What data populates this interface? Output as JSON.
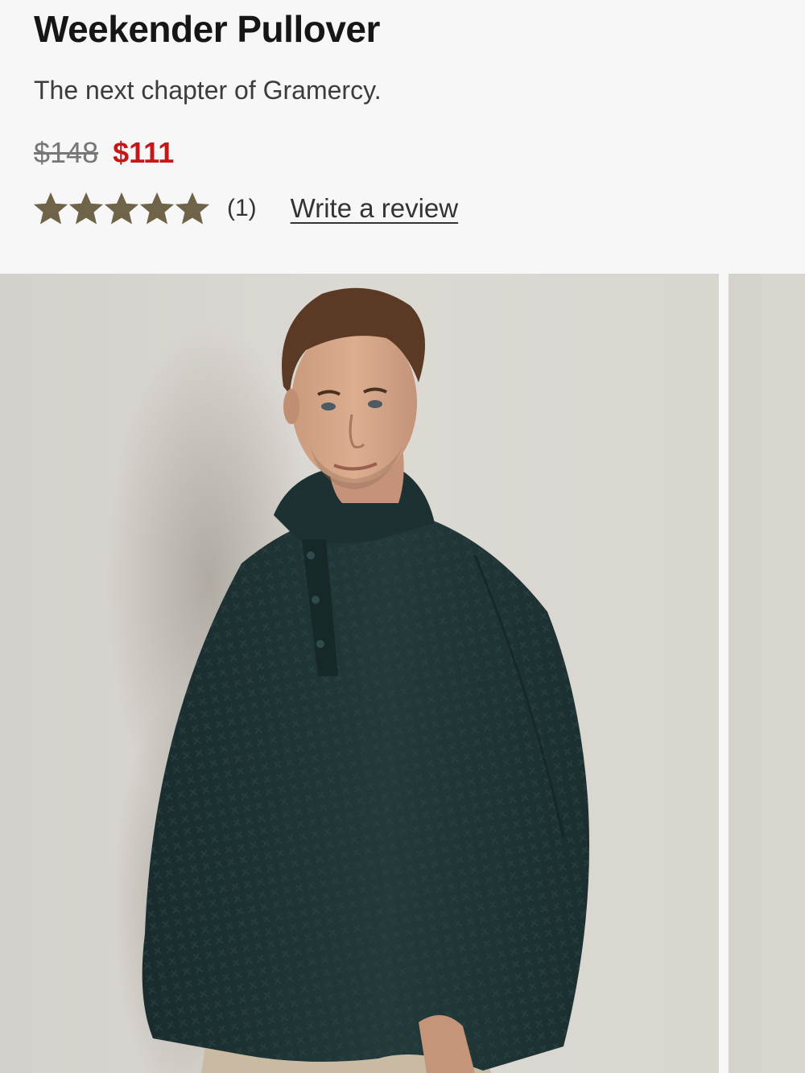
{
  "product": {
    "title": "Weekender Pullover",
    "subtitle": "The next chapter of Gramercy.",
    "price_original": "$148",
    "price_sale": "$111",
    "rating": 5,
    "rating_max": 5,
    "review_count": "(1)",
    "write_review_label": "Write a review"
  },
  "icons": {
    "star": "star-icon"
  },
  "colors": {
    "sale_price": "#c41818",
    "star": "#6f6449",
    "background": "#f8f7f7",
    "sweater": "#1f3536"
  }
}
